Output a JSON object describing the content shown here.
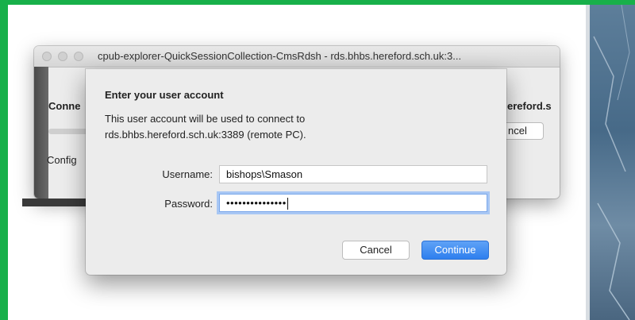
{
  "back_window": {
    "title": "cpub-explorer-QuickSessionCollection-CmsRdsh - rds.bhbs.hereford.sch.uk:3...",
    "connecting_label": "Conne",
    "host_fragment": "ereford.s",
    "cancel_label": "ncel",
    "config_label": "Config"
  },
  "dialog": {
    "title": "Enter your user account",
    "message_line1": "This user account will be used to connect to",
    "message_line2": "rds.bhbs.hereford.sch.uk:3389 (remote PC).",
    "username_label": "Username:",
    "username_value": "bishops\\Smason",
    "password_label": "Password:",
    "password_value": "•••••••••••••••",
    "cancel_label": "Cancel",
    "continue_label": "Continue"
  },
  "colors": {
    "border": "#18b04a",
    "accent": "#2e7fee"
  }
}
